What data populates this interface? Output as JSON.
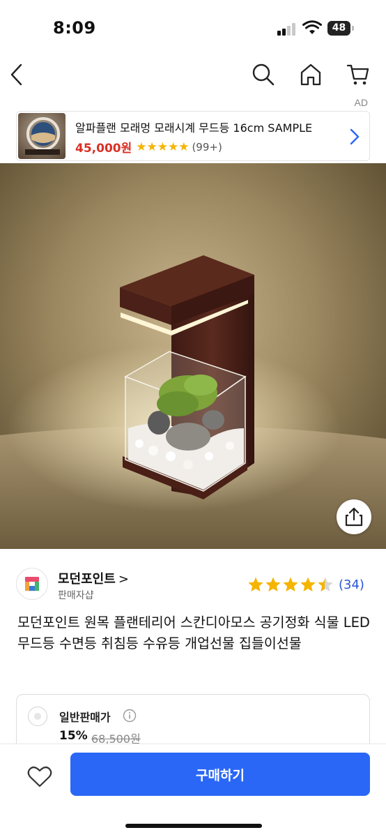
{
  "status": {
    "time": "8:09",
    "battery": "48"
  },
  "nav": {
    "back_icon": "chevron-left-icon",
    "search_icon": "search-icon",
    "home_icon": "home-icon",
    "cart_icon": "cart-icon"
  },
  "ad": {
    "tag": "AD",
    "title": "알파플랜 모래멍 모래시계 무드등 16cm SAMPLE",
    "price": "45,000원",
    "rating": 5,
    "stars": "★★★★★",
    "review_count": "(99+)"
  },
  "seller": {
    "name": "모던포인트",
    "arrow": ">",
    "type": "판매자샵",
    "rating": 4.5,
    "review_count": "(34)"
  },
  "product": {
    "title": "모던포인트 원목 플랜테리어 스칸디아모스 공기정화 식물 LED 무드등 수면등 취침등 수유등 개업선물 집들이선물"
  },
  "price_option": {
    "label": "일반판매가",
    "discount": "15%",
    "original_price": "68,500원"
  },
  "bottom": {
    "buy_label": "구매하기"
  },
  "colors": {
    "accent": "#2b67f6",
    "ad_price": "#d93025",
    "star": "#f5b400",
    "link": "#2a55d6"
  }
}
